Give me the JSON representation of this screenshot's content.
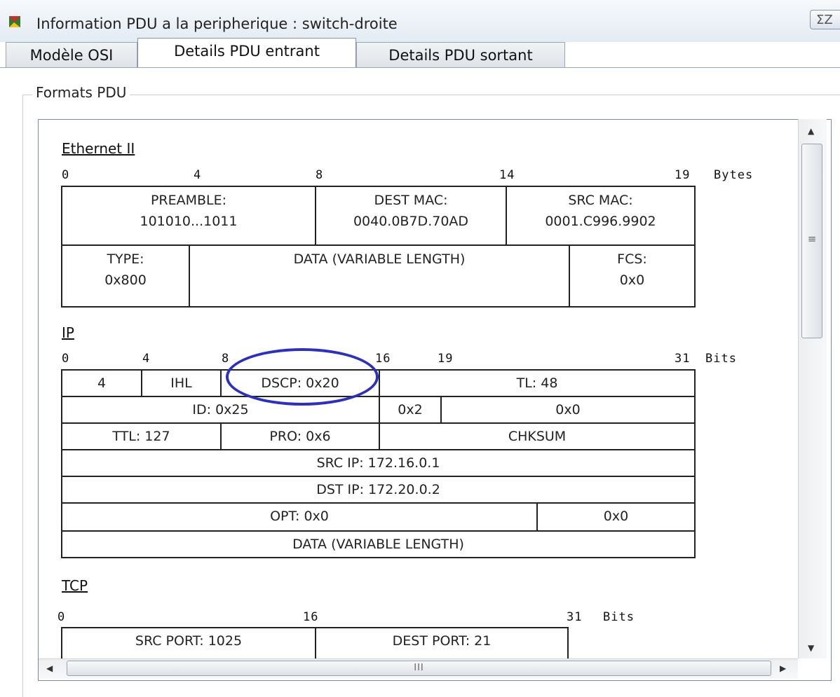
{
  "window": {
    "title": "Information PDU a la peripherique : switch-droite",
    "close_glyph": "ΣΖ"
  },
  "tabs": [
    {
      "label": "Modèle OSI",
      "active": false
    },
    {
      "label": "Details PDU entrant",
      "active": true
    },
    {
      "label": "Details PDU sortant",
      "active": false
    }
  ],
  "group": {
    "legend": "Formats PDU"
  },
  "ethernet": {
    "title": "Ethernet II",
    "scale": {
      "marks": [
        "0",
        "4",
        "8",
        "14",
        "19"
      ],
      "unit": "Bytes"
    },
    "row1": {
      "preamble": {
        "label": "PREAMBLE:",
        "value": "101010...1011"
      },
      "dest_mac": {
        "label": "DEST MAC:",
        "value": "0040.0B7D.70AD"
      },
      "src_mac": {
        "label": "SRC MAC:",
        "value": "0001.C996.9902"
      }
    },
    "row2": {
      "type": {
        "label": "TYPE:",
        "value": "0x800"
      },
      "data": "DATA (VARIABLE LENGTH)",
      "fcs": {
        "label": "FCS:",
        "value": "0x0"
      }
    }
  },
  "ip": {
    "title": "IP",
    "scale": {
      "marks": [
        "0",
        "4",
        "8",
        "16",
        "19",
        "31"
      ],
      "unit": "Bits"
    },
    "version": "4",
    "ihl": "IHL",
    "dscp": "DSCP: 0x20",
    "tl": "TL: 48",
    "id": "ID: 0x25",
    "flags": "0x2",
    "frag": "0x0",
    "ttl": "TTL: 127",
    "pro": "PRO: 0x6",
    "chksum": "CHKSUM",
    "src_ip": "SRC IP: 172.16.0.1",
    "dst_ip": "DST IP: 172.20.0.2",
    "opt": "OPT: 0x0",
    "padding": "0x0",
    "data": "DATA (VARIABLE LENGTH)"
  },
  "tcp": {
    "title": "TCP",
    "scale": {
      "marks": [
        "0",
        "16",
        "31"
      ],
      "unit": "Bits"
    },
    "src_port": "SRC PORT: 1025",
    "dest_port": "DEST PORT: 21"
  },
  "scrollbar": {
    "grip_v": "≡",
    "grip_h": "III"
  },
  "highlight": {
    "color": "#2d30b8",
    "target": "DSCP: 0x20"
  }
}
